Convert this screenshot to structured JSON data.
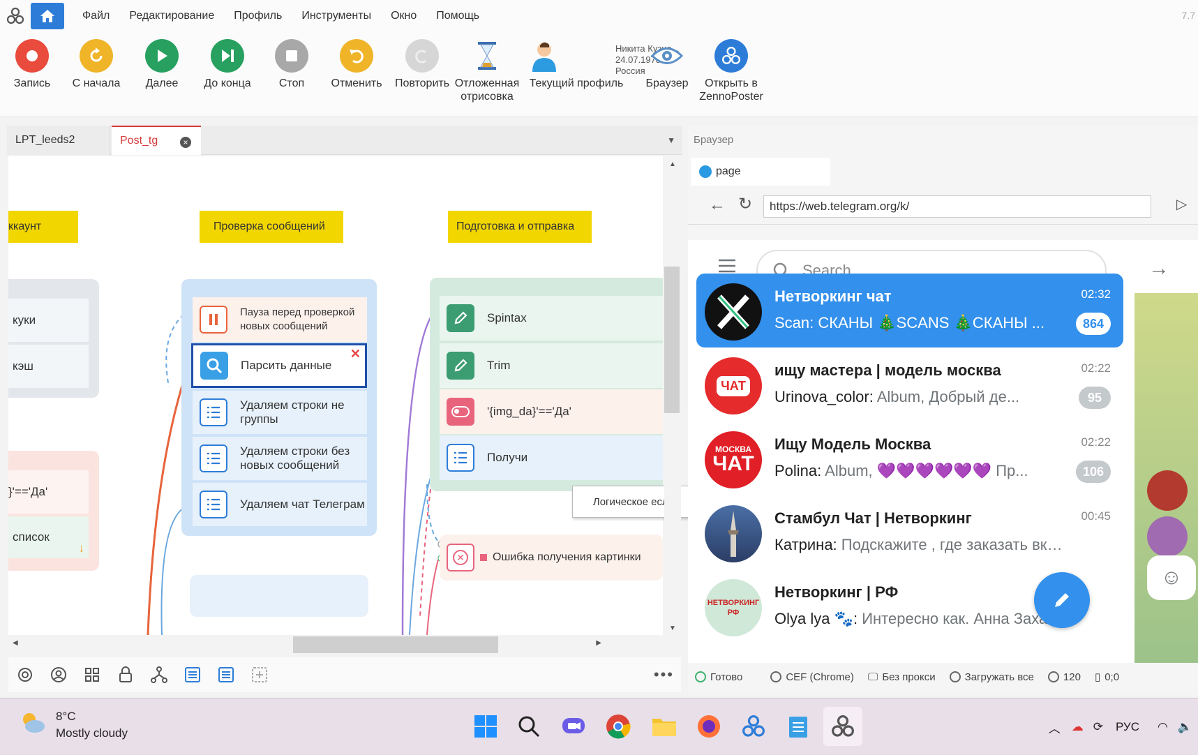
{
  "app": {
    "version": "7.7",
    "menu": [
      "Файл",
      "Редактирование",
      "Профиль",
      "Инструменты",
      "Окно",
      "Помощь"
    ]
  },
  "toolbar": {
    "buttons": [
      {
        "label": "Запись",
        "icon": "record-icon",
        "color": "#e94b3c"
      },
      {
        "label": "С начала",
        "icon": "restart-icon",
        "color": "#f0b429"
      },
      {
        "label": "Далее",
        "icon": "play-icon",
        "color": "#27a060"
      },
      {
        "label": "До конца",
        "icon": "skip-end-icon",
        "color": "#27a060"
      },
      {
        "label": "Стоп",
        "icon": "stop-icon",
        "color": "#a8a8a8"
      },
      {
        "label": "Отменить",
        "icon": "undo-icon",
        "color": "#f0b429"
      },
      {
        "label": "Повторить",
        "icon": "redo-icon",
        "color": "#cfcfcf"
      },
      {
        "label": "Отложенная",
        "label2": "отрисовка",
        "icon": "hourglass-icon"
      },
      {
        "label": "Текущий профиль",
        "icon": "user-icon"
      },
      {
        "label": "Браузер",
        "icon": "eye-icon"
      },
      {
        "label": "Открыть в",
        "label2": "ZennoPoster",
        "icon": "zennoposter-icon",
        "color": "#2d7dd8"
      }
    ],
    "profile": {
      "name": "Никита Кузне...",
      "date": "24.07.1978",
      "country": "Россия"
    }
  },
  "editor": {
    "tabs": [
      {
        "label": "LPT_leeds2"
      },
      {
        "label": "Post_tg"
      }
    ],
    "groups": [
      {
        "label": "ккаунт"
      },
      {
        "label": "Проверка сообщений"
      },
      {
        "label": "Подготовка и отправка"
      }
    ],
    "left_nodes": [
      "куки",
      "кэш",
      "}'=='Да'",
      "список"
    ],
    "middle_nodes": [
      "Пауза перед проверкой новых сообщений",
      "Парсить данные",
      "Удаляем строки не группы",
      "Удаляем строки без новых сообщений",
      "Удаляем чат Телеграм"
    ],
    "right_nodes": [
      "Spintax",
      "Trim",
      "'{img_da}'=='Да'",
      "Получи",
      "Ошибка получения картинки"
    ],
    "tooltip": "Логическое если"
  },
  "browser": {
    "title": "Браузер",
    "tab": "page",
    "url": "https://web.telegram.org/k/",
    "search_placeholder": "Search",
    "chats": [
      {
        "name": "Нетворкинг чат",
        "time": "02:32",
        "sender": "",
        "msg": "Scan: СКАНЫ 🎄SCANS 🎄СКАНЫ ...",
        "badge": "864",
        "active": true
      },
      {
        "name": "ищу мастера | модель москва",
        "time": "02:22",
        "sender": "Urinova_color:",
        "msg": " Album, Добрый де...",
        "badge": "95"
      },
      {
        "name": "Ищу Модель Москва",
        "time": "02:22",
        "sender": "Polina:",
        "msg": " Album, 💜💜💜💜💜💜 Пр...",
        "badge": "106"
      },
      {
        "name": "Стамбул Чат | Нетворкинг",
        "time": "00:45",
        "sender": "Катрина:",
        "msg": " Подскажите , где заказать вкус...",
        "badge": ""
      },
      {
        "name": "Нетворкинг | РФ",
        "time": "",
        "sender": "Olya lya 🐾:",
        "msg": " Интересно как. Анна Захаров...",
        "badge": ""
      }
    ],
    "avatar_texts": {
      "chat2": "ЧАТ",
      "chat3_top": "МОСКВА",
      "chat3_bottom": "ЧАТ",
      "chat5": "НЕТВОРКИНГ РФ"
    },
    "status": [
      "Готово",
      "CEF (Chrome)",
      "Без прокси",
      "Загружать все",
      "120",
      "0;0"
    ]
  },
  "taskbar": {
    "weather_temp": "8°C",
    "weather_desc": "Mostly cloudy",
    "lang": "РУС"
  }
}
